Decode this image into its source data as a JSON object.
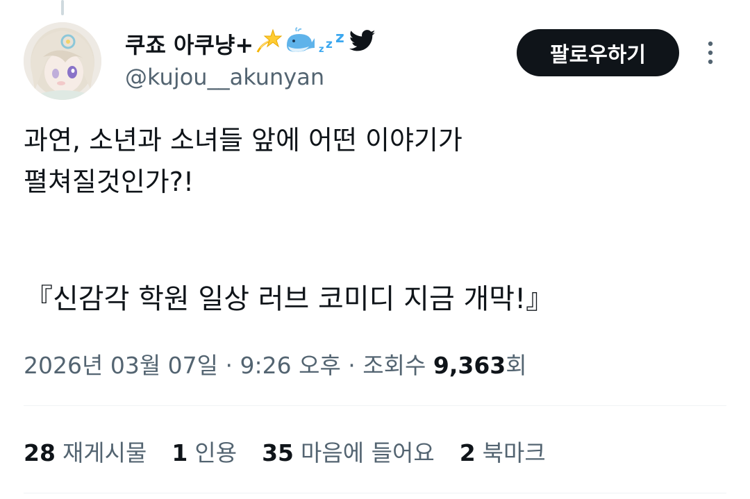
{
  "user": {
    "display_name": "쿠죠 아쿠냥+",
    "handle": "@kujou__akunyan",
    "name_emojis": [
      "dizzy-star-icon",
      "whale-icon",
      "zzz-icon",
      "twitter-bird-icon"
    ]
  },
  "actions": {
    "follow_label": "팔로우하기"
  },
  "tweet": {
    "line1": "과연, 소년과 소녀들 앞에 어떤 이야기가",
    "line2": "펼쳐질것인가?!",
    "line3": "『신감각 학원 일상 러브 코미디 지금 개막!』"
  },
  "meta": {
    "timestamp": "2026년 03월 07일 · 9:26 오후 · 조회수 ",
    "views": "9,363",
    "views_suffix": "회"
  },
  "stats": [
    {
      "count": "28",
      "label": "재게시물"
    },
    {
      "count": "1",
      "label": "인용"
    },
    {
      "count": "35",
      "label": "마음에 들어요"
    },
    {
      "count": "2",
      "label": "북마크"
    }
  ],
  "colors": {
    "text": "#0f1419",
    "secondary": "#536471",
    "twitter_blue": "#1d9bf0",
    "divider": "#eff3f4",
    "button_bg": "#0f1419"
  }
}
